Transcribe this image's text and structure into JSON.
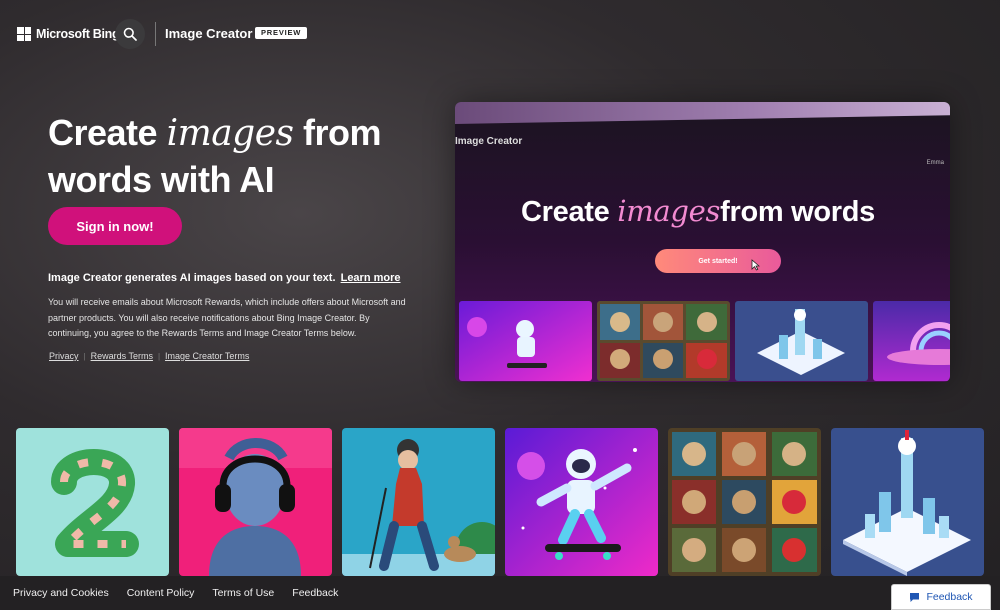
{
  "header": {
    "brand": "Microsoft Bing",
    "app_title": "Image Creator",
    "badge": "PREVIEW"
  },
  "hero": {
    "title_pre": "Create ",
    "title_em": "images",
    "title_post": " from words with AI",
    "signin_label": "Sign in now!",
    "lead": "Image Creator generates AI images based on your text.",
    "learn_more": "Learn more",
    "body": "You will receive emails about Microsoft Rewards, which include offers about Microsoft and partner products. You will also receive notifications about Bing Image Creator. By continuing, you agree to the Rewards Terms and Image Creator Terms below.",
    "links": [
      "Privacy",
      "Rewards Terms",
      "Image Creator Terms"
    ]
  },
  "preview": {
    "app_title": "Image Creator",
    "user": "Emma",
    "headline_pre": "Create ",
    "headline_em": "images",
    "headline_post": "from words",
    "cta": "Get started!"
  },
  "footer": {
    "links": [
      "Privacy and Cookies",
      "Content Policy",
      "Terms of Use",
      "Feedback"
    ],
    "feedback_button": "Feedback"
  },
  "colors": {
    "accent": "#d0117b",
    "feedback_text": "#1f56b3"
  },
  "icons": {
    "search": "search-icon",
    "logo": "microsoft-logo-icon",
    "feedback": "chat-bubble-icon"
  }
}
